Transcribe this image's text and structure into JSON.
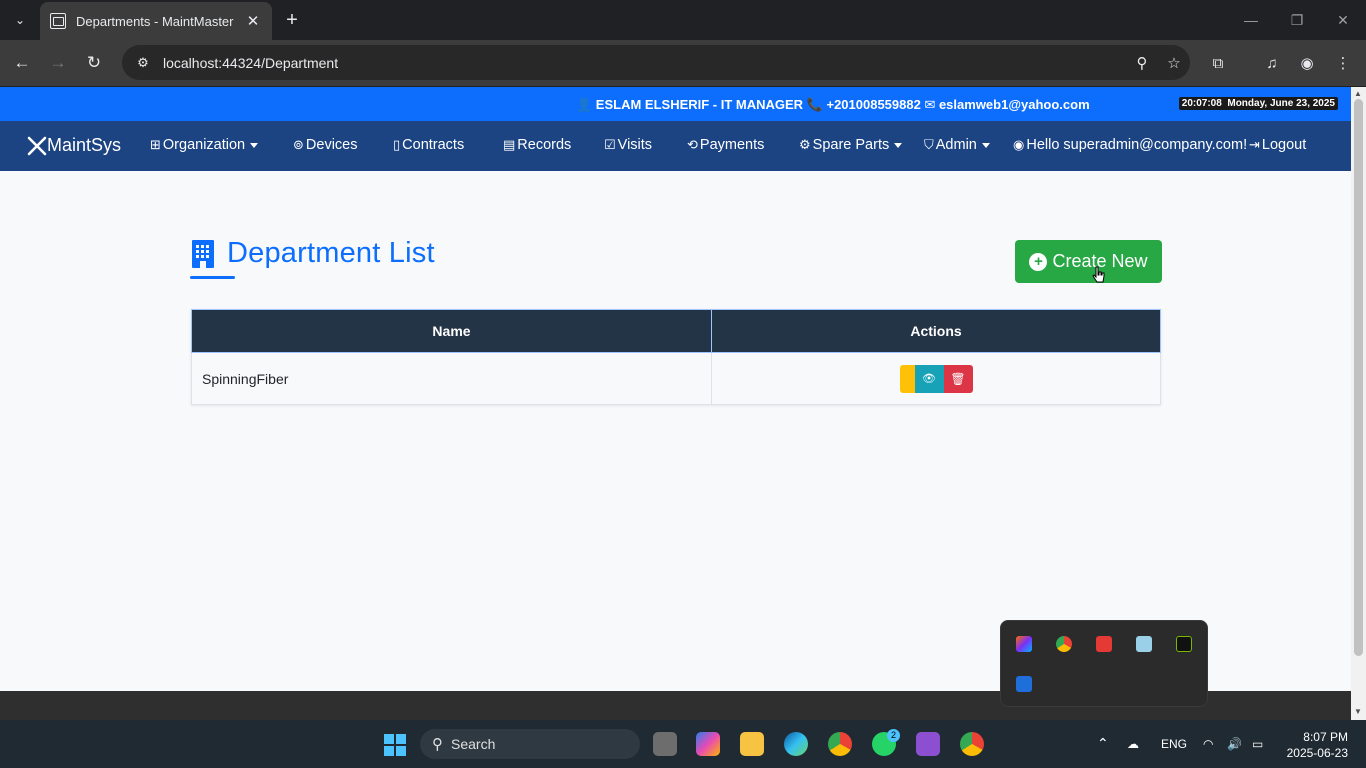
{
  "browser": {
    "tab_title": "Departments - MaintMaster",
    "url": "localhost:44324/Department"
  },
  "topinfo": {
    "contact": "👤 ESLAM ELSHERIF - IT MANAGER 📞 +201008559882 ✉ eslamweb1@yahoo.com",
    "time": "20:07:08",
    "date": "Monday, June 23, 2025"
  },
  "nav": {
    "brand": "MaintSys",
    "items": [
      {
        "label": "Organization",
        "icon": "sitemap-icon"
      },
      {
        "label": "Devices",
        "icon": "chip-icon"
      },
      {
        "label": "Contracts",
        "icon": "document-icon"
      },
      {
        "label": "Records",
        "icon": "records-icon"
      },
      {
        "label": "Visits",
        "icon": "calendar-check-icon"
      },
      {
        "label": "Payments",
        "icon": "payments-icon"
      },
      {
        "label": "Spare Parts",
        "icon": "gear-icon"
      },
      {
        "label": "Admin",
        "icon": "shield-icon"
      }
    ],
    "greeting": "Hello superadmin@company.com!",
    "logout": "Logout"
  },
  "main": {
    "title": "Department List",
    "create_label": "Create New",
    "columns": [
      "Name",
      "Actions"
    ],
    "rows": [
      {
        "name": "SpinningFiber"
      }
    ]
  },
  "taskbar": {
    "search": "Search",
    "lang": "ENG",
    "time": "8:07 PM",
    "date": "2025-06-23",
    "whatsapp_badge": "2"
  },
  "colors": {
    "topinfo": "#0d6efd",
    "navbar": "#1c4483",
    "create": "#28a745",
    "header": "#243447"
  }
}
